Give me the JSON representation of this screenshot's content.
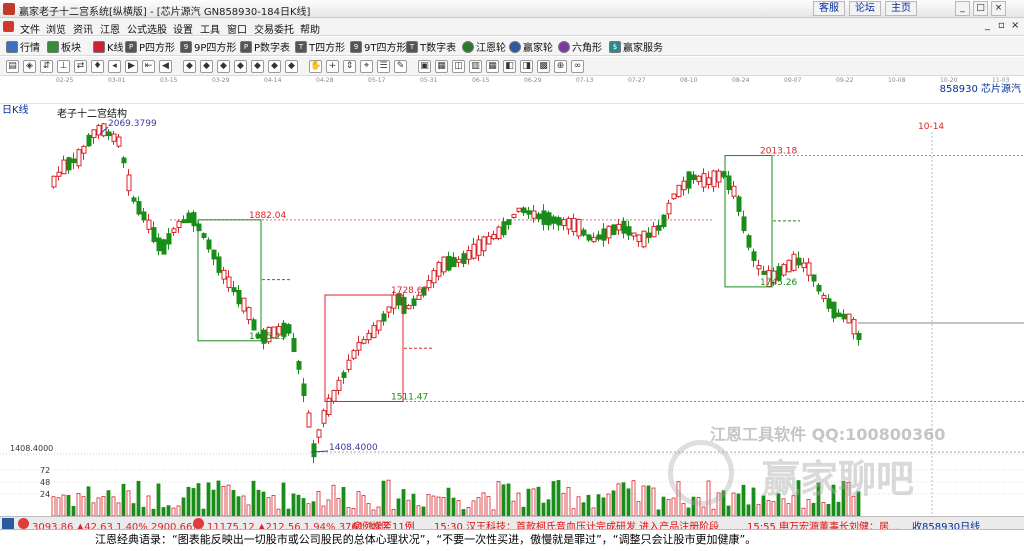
{
  "window": {
    "title": "赢家老子十二宫系统[纵横版] - [芯片源汽  GN858930-184日K线]",
    "links": [
      "客服",
      "论坛",
      "主页"
    ]
  },
  "menu": [
    "文件",
    "浏览",
    "资讯",
    "江恩",
    "公式选股",
    "设置",
    "工具",
    "窗口",
    "交易委托",
    "帮助"
  ],
  "toolbar": [
    {
      "label": "行情",
      "icon": "table-icon"
    },
    {
      "label": "板块",
      "icon": "grid-icon"
    },
    {
      "label": "K线",
      "icon": "candle-icon"
    },
    {
      "label": "P四方形",
      "icon": "p-square-icon"
    },
    {
      "label": "9P四方形",
      "icon": "9p-square-icon"
    },
    {
      "label": "P数字表",
      "icon": "p-number-table-icon"
    },
    {
      "label": "T四方形",
      "icon": "t-square-icon"
    },
    {
      "label": "9T四方形",
      "icon": "9t-square-icon"
    },
    {
      "label": "T数字表",
      "icon": "t-number-table-icon"
    },
    {
      "label": "江恩轮",
      "icon": "gann-wheel-icon"
    },
    {
      "label": "赢家轮",
      "icon": "winner-wheel-icon"
    },
    {
      "label": "六角形",
      "icon": "hexagon-icon"
    },
    {
      "label": "赢家服务",
      "icon": "service-icon"
    }
  ],
  "date_axis": [
    "02-25",
    "03-01",
    "03-15",
    "03-29",
    "04-14",
    "04-28",
    "05-17",
    "05-31",
    "06-15",
    "06-29",
    "07-13",
    "07-27",
    "08-10",
    "08-24",
    "09-07",
    "09-22",
    "10-08",
    "10-20",
    "11-03"
  ],
  "chart": {
    "kind_label": "日K线",
    "code_label": "858930  芯片源汽",
    "structure_label": "老子十二宫结构",
    "marker_label": "10-14",
    "price_labels": [
      "2069.3799",
      "1882.04",
      "1635.25",
      "1728.67",
      "1511.47",
      "1408.4000",
      "2013.18",
      "1745.26"
    ],
    "left_axis_price": "1408.4000",
    "volume_ticks": [
      "72",
      "48",
      "24"
    ],
    "colors": {
      "up": "#d8242b",
      "down": "#1a8c1a",
      "box": "#1c8a1c",
      "box_red": "#d8242b"
    }
  },
  "ticker": {
    "sh_index": "3093.86 ▲42.63 1.40% 2900.66亿",
    "sz_index": "11175.12 ▲212.56 1.94% 3761.39亿",
    "news": [
      "病例增至11例",
      "15:30  汉王科技：首款柯氏音血压计完成研发 进入产品注册阶段",
      "15:55  申万宏源董事长刘健：居…"
    ],
    "code": "收858930日线"
  },
  "footer": "江恩经典语录：“图表能反映出一切股市或公司股民的总体心理状况”，“不要一次性买进，傲慢就是罪过”，“调整只会让股市更加健康”。",
  "watermark": {
    "software": "江恩工具软件  QQ:100800360",
    "brand": "赢家聊吧"
  }
}
